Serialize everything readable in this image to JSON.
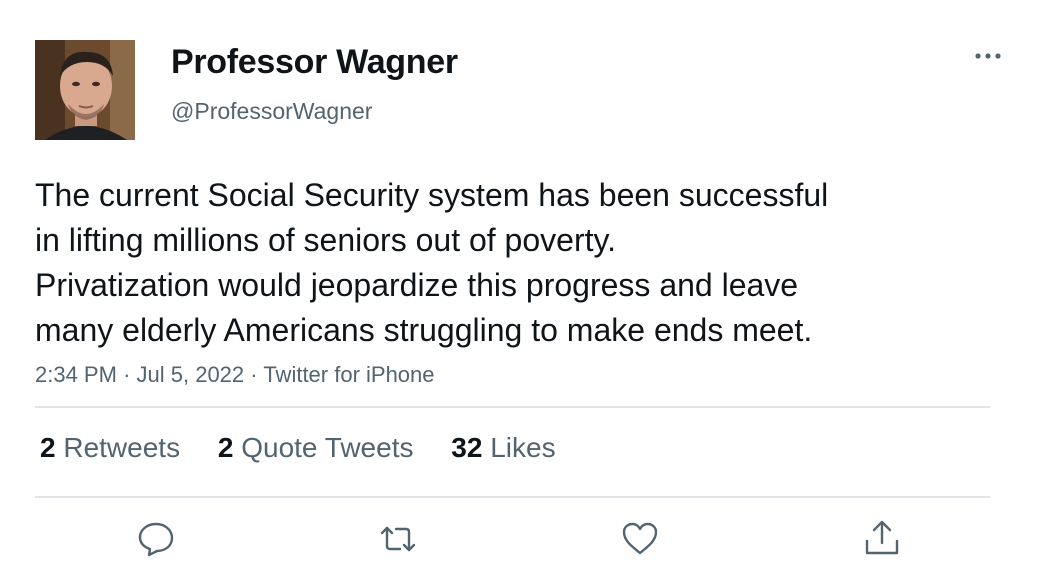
{
  "author": {
    "display_name": "Professor Wagner",
    "handle": "@ProfessorWagner",
    "avatar_icon": "profile-photo"
  },
  "tweet": {
    "lines": [
      "The current Social Security system has been successful",
      "in lifting millions of seniors out of poverty.",
      "Privatization would jeopardize this progress and leave",
      "many elderly Americans struggling to make ends meet."
    ],
    "time": "2:34 PM",
    "date": "Jul 5, 2022",
    "source": "Twitter for iPhone",
    "separator": "·"
  },
  "stats": {
    "retweets": {
      "count": "2",
      "label": "Retweets"
    },
    "quote_tweets": {
      "count": "2",
      "label": "Quote Tweets"
    },
    "likes": {
      "count": "32",
      "label": "Likes"
    }
  },
  "actions": {
    "icons": [
      "reply-icon",
      "retweet-icon",
      "like-icon",
      "share-icon"
    ]
  },
  "colors": {
    "text": "#0f1419",
    "secondary": "#536471",
    "divider": "#e1e4e8",
    "icon": "#536471"
  }
}
